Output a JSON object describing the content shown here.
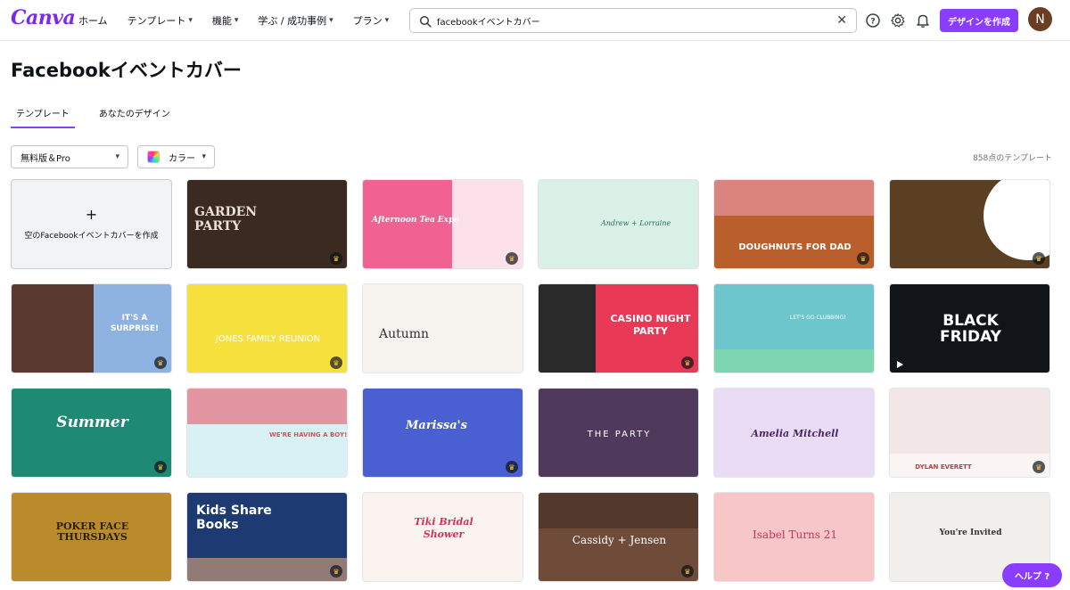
{
  "header": {
    "logo": "Canva",
    "nav": [
      {
        "label": "ホーム",
        "has_dropdown": false
      },
      {
        "label": "テンプレート",
        "has_dropdown": true
      },
      {
        "label": "機能",
        "has_dropdown": true
      },
      {
        "label": "学ぶ / 成功事例",
        "has_dropdown": true
      },
      {
        "label": "プラン",
        "has_dropdown": true
      }
    ],
    "search_value": "facebookイベントカバー",
    "create_button": "デザインを作成",
    "avatar_initial": "N",
    "icons": [
      "search-icon",
      "close-icon",
      "help-icon",
      "gear-icon",
      "bell-icon"
    ]
  },
  "page": {
    "title": "Facebookイベントカバー",
    "tabs": [
      {
        "label": "テンプレート",
        "active": true
      },
      {
        "label": "あなたのデザイン",
        "active": false
      }
    ],
    "filters": {
      "price": "無料版＆Pro",
      "color": "カラー"
    },
    "count": "858点のテンプレート"
  },
  "grid": {
    "blank_card": {
      "icon": "+",
      "label": "空のFacebookイベントカバーを作成"
    },
    "templates": [
      {
        "title": "GARDEN PARTY",
        "bg": "#3a2a1f",
        "fg": "#e9e1d3"
      },
      {
        "title": "Afternoon Tea Expo",
        "bg": "#f06292",
        "fg": "#ffffff"
      },
      {
        "title": "Andrew + Lorraine",
        "bg": "#d8f0e6",
        "fg": "#2f6f62"
      },
      {
        "title": "DOUGHNUTS FOR DAD",
        "bg": "#b85f2c",
        "fg": "#ffffff"
      },
      {
        "title": "",
        "bg": "#5a3f22",
        "fg": "#ffffff"
      },
      {
        "title": "IT'S A SURPRISE!",
        "bg": "#8fb3e0",
        "fg": "#ffffff"
      },
      {
        "title": "JONES FAMILY REUNION",
        "bg": "#f6e03c",
        "fg": "#ffffff"
      },
      {
        "title": "Autumn",
        "bg": "#f6f3ef",
        "fg": "#333333"
      },
      {
        "title": "CASINO NIGHT PARTY",
        "bg": "#e83a56",
        "fg": "#ffffff"
      },
      {
        "title": "LET'S GO CLUBBING!",
        "bg": "#6cc6cc",
        "fg": "#ffffff"
      },
      {
        "title": "BLACK FRIDAY",
        "bg": "#111418",
        "fg": "#ffffff"
      },
      {
        "title": "Summer",
        "bg": "#1f8a74",
        "fg": "#ffffff"
      },
      {
        "title": "WE'RE HAVING A BOY!",
        "bg": "#d9f1f5",
        "fg": "#e84b5b"
      },
      {
        "title": "Marissa's",
        "bg": "#4a5fd2",
        "fg": "#ffffff"
      },
      {
        "title": "THE PARTY",
        "bg": "#4f3a5c",
        "fg": "#ffffff"
      },
      {
        "title": "Amelia Mitchell",
        "bg": "#eadcf5",
        "fg": "#4a2a6a"
      },
      {
        "title": "DYLAN EVERETT",
        "bg": "#f3e6e6",
        "fg": "#c23b3b"
      },
      {
        "title": "POKER FACE THURSDAYS",
        "bg": "#b98b2a",
        "fg": "#2b1e08"
      },
      {
        "title": "Kids Share Books",
        "bg": "#1e3a73",
        "fg": "#ffffff"
      },
      {
        "title": "Tiki Bridal Shower",
        "bg": "#fbf3f0",
        "fg": "#d23459"
      },
      {
        "title": "Cassidy + Jensen",
        "bg": "#6f4c3a",
        "fg": "#ffffff"
      },
      {
        "title": "Isabel Turns 21",
        "bg": "#f7c6c7",
        "fg": "#c2375a"
      },
      {
        "title": "You're Invited",
        "bg": "#f1efec",
        "fg": "#333333"
      }
    ]
  },
  "help_button": "ヘルプ ?"
}
